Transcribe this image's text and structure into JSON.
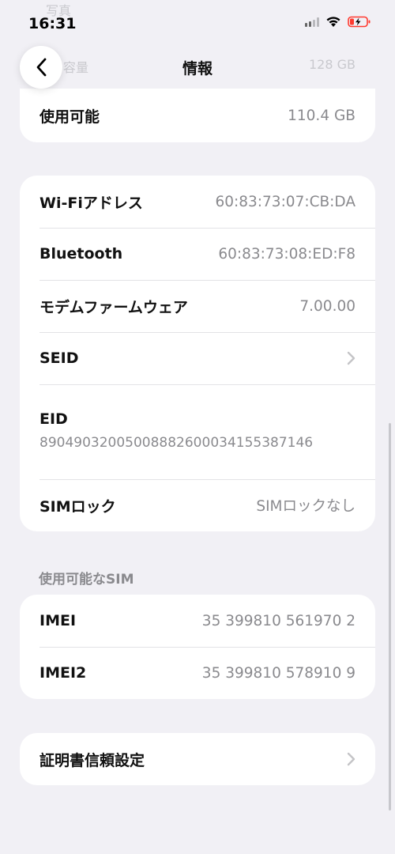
{
  "status_bar": {
    "time": "16:31"
  },
  "nav": {
    "title": "情報"
  },
  "ghost": {
    "row1_label": "写真",
    "row2_label": "容量",
    "row2_value": "128 GB"
  },
  "storage_card": {
    "available_label": "使用可能",
    "available_value": "110.4 GB"
  },
  "info_card": {
    "wifi_label": "Wi-Fiアドレス",
    "wifi_value": "60:83:73:07:CB:DA",
    "bt_label": "Bluetooth",
    "bt_value": "60:83:73:08:ED:F8",
    "modem_label": "モデムファームウェア",
    "modem_value": "7.00.00",
    "seid_label": "SEID",
    "eid_label": "EID",
    "eid_value": "89049032005008882600034155387146",
    "sim_lock_label": "SIMロック",
    "sim_lock_value": "SIMロックなし"
  },
  "sim_section": {
    "header": "使用可能なSIM",
    "imei_label": "IMEI",
    "imei_value": "35 399810 561970 2",
    "imei2_label": "IMEI2",
    "imei2_value": "35 399810 578910 9"
  },
  "cert_card": {
    "label": "証明書信頼設定"
  },
  "colors": {
    "background": "#f1f0f5",
    "card": "#ffffff",
    "secondary_text": "#8a8a8e",
    "battery_red": "#ff3b30"
  }
}
